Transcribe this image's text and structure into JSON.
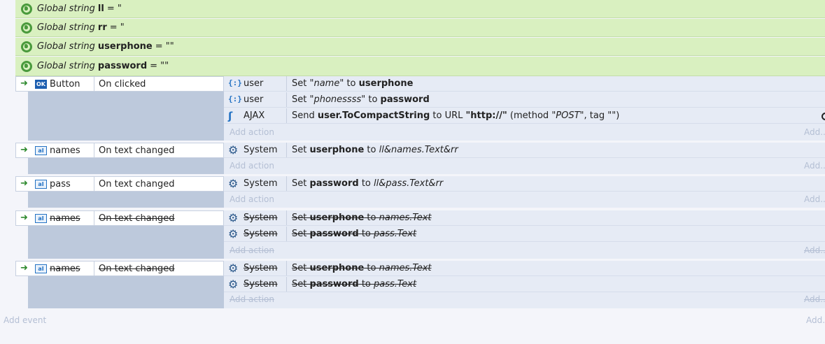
{
  "globals": [
    {
      "keyword": "Global string",
      "name": "ll",
      "rest": "= \""
    },
    {
      "keyword": "Global string",
      "name": "rr",
      "rest": "= \""
    },
    {
      "keyword": "Global string",
      "name": "userphone",
      "rest": "= \"\""
    },
    {
      "keyword": "Global string",
      "name": "password",
      "rest": "= \"\""
    }
  ],
  "events": [
    {
      "object": "Button",
      "trigger": "On clicked",
      "actions": [
        {
          "object": "user",
          "text_parts": [
            "Set ",
            "\"name\"",
            " to ",
            "userphone"
          ]
        },
        {
          "object": "user",
          "text_parts": [
            "Set ",
            "\"phonessss\"",
            " to ",
            "password"
          ]
        },
        {
          "object": "AJAX",
          "text_parts": [
            "Send ",
            "user.ToCompactString",
            " to URL ",
            "\"http://\"",
            " (method ",
            "\"POST\"",
            ", tag ",
            "\"\"",
            ")"
          ]
        }
      ],
      "add_action": "Add action",
      "add_action_right": "Add..."
    },
    {
      "object": "names",
      "trigger": "On text changed",
      "actions": [
        {
          "object": "System",
          "text_parts": [
            "Set ",
            "userphone",
            " to ",
            "ll&names.Text&rr"
          ]
        }
      ],
      "add_action": "Add action",
      "add_action_right": "Add..."
    },
    {
      "object": "pass",
      "trigger": "On text changed",
      "actions": [
        {
          "object": "System",
          "text_parts": [
            "Set ",
            "password",
            " to ",
            "ll&pass.Text&rr"
          ]
        }
      ],
      "add_action": "Add action",
      "add_action_right": "Add..."
    },
    {
      "object": "names",
      "trigger": "On text changed",
      "disabled": true,
      "actions": [
        {
          "object": "System",
          "text_parts": [
            "Set ",
            "userphone",
            " to ",
            "names.Text"
          ]
        },
        {
          "object": "System",
          "text_parts": [
            "Set ",
            "password",
            " to ",
            "pass.Text"
          ]
        }
      ],
      "add_action": "Add action",
      "add_action_right": "Add..."
    },
    {
      "object": "names",
      "trigger": "On text changed",
      "disabled": true,
      "actions": [
        {
          "object": "System",
          "text_parts": [
            "Set ",
            "userphone",
            " to ",
            "names.Text"
          ]
        },
        {
          "object": "System",
          "text_parts": [
            "Set ",
            "password",
            " to ",
            "pass.Text"
          ]
        }
      ],
      "add_action": "Add action",
      "add_action_right": "Add..."
    }
  ],
  "footer": {
    "add_event": "Add event",
    "add_right": "Add..."
  },
  "colors": {
    "global_bg": "#d9f0c0",
    "event_left_bg": "#bdc9dc",
    "event_right_bg": "#e6ebf5",
    "accent": "#2573c4"
  },
  "icons": {
    "global": "globe-icon",
    "trigger_arrow": "arrow-right-icon",
    "button_object": "button-object-icon",
    "text_input_object": "text-input-icon",
    "dictionary_object": "dictionary-icon",
    "system_object": "gear-icon",
    "ajax_object": "ajax-icon"
  }
}
